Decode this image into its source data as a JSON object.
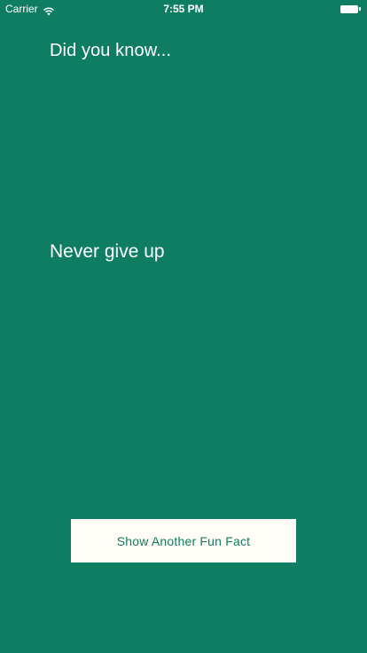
{
  "status_bar": {
    "carrier": "Carrier",
    "wifi_icon": "wifi-icon",
    "time": "7:55 PM",
    "battery_icon": "battery-icon"
  },
  "main": {
    "heading": "Did you know...",
    "fact": "Never give up",
    "button_label": "Show Another Fun Fact"
  },
  "colors": {
    "background": "#0F7D62",
    "text": "#FFFFFF",
    "button_background": "#FFFDF5",
    "button_text": "#0F7D62"
  }
}
